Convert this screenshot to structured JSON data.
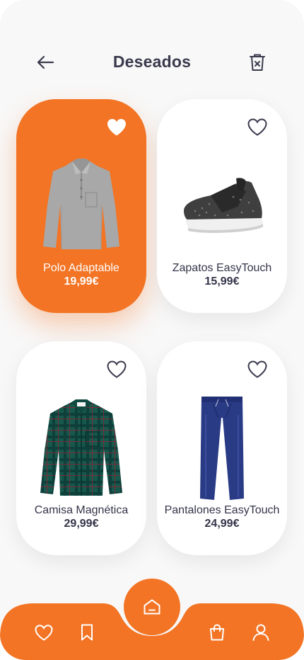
{
  "header": {
    "title": "Deseados",
    "back_icon": "arrow-left-icon",
    "delete_icon": "trash-icon"
  },
  "colors": {
    "accent": "#f37424",
    "text": "#34344a",
    "card": "#ffffff",
    "background": "#f8f8f8"
  },
  "products": [
    {
      "name": "Polo Adaptable",
      "price": "19,99€",
      "selected": true,
      "favorited": true,
      "image": "grey-polo-shirt"
    },
    {
      "name": "Zapatos EasyTouch",
      "price": "15,99€",
      "selected": false,
      "favorited": false,
      "image": "black-knit-sneaker"
    },
    {
      "name": "Camisa Magnética",
      "price": "29,99€",
      "selected": false,
      "favorited": false,
      "image": "green-plaid-shirt"
    },
    {
      "name": "Pantalones EasyTouch",
      "price": "24,99€",
      "selected": false,
      "favorited": false,
      "image": "navy-track-pants"
    }
  ],
  "bottom_nav": {
    "items": [
      "heart-icon",
      "bookmark-icon",
      "home-icon",
      "shopping-bag-icon",
      "user-icon"
    ],
    "active": "home-icon"
  }
}
